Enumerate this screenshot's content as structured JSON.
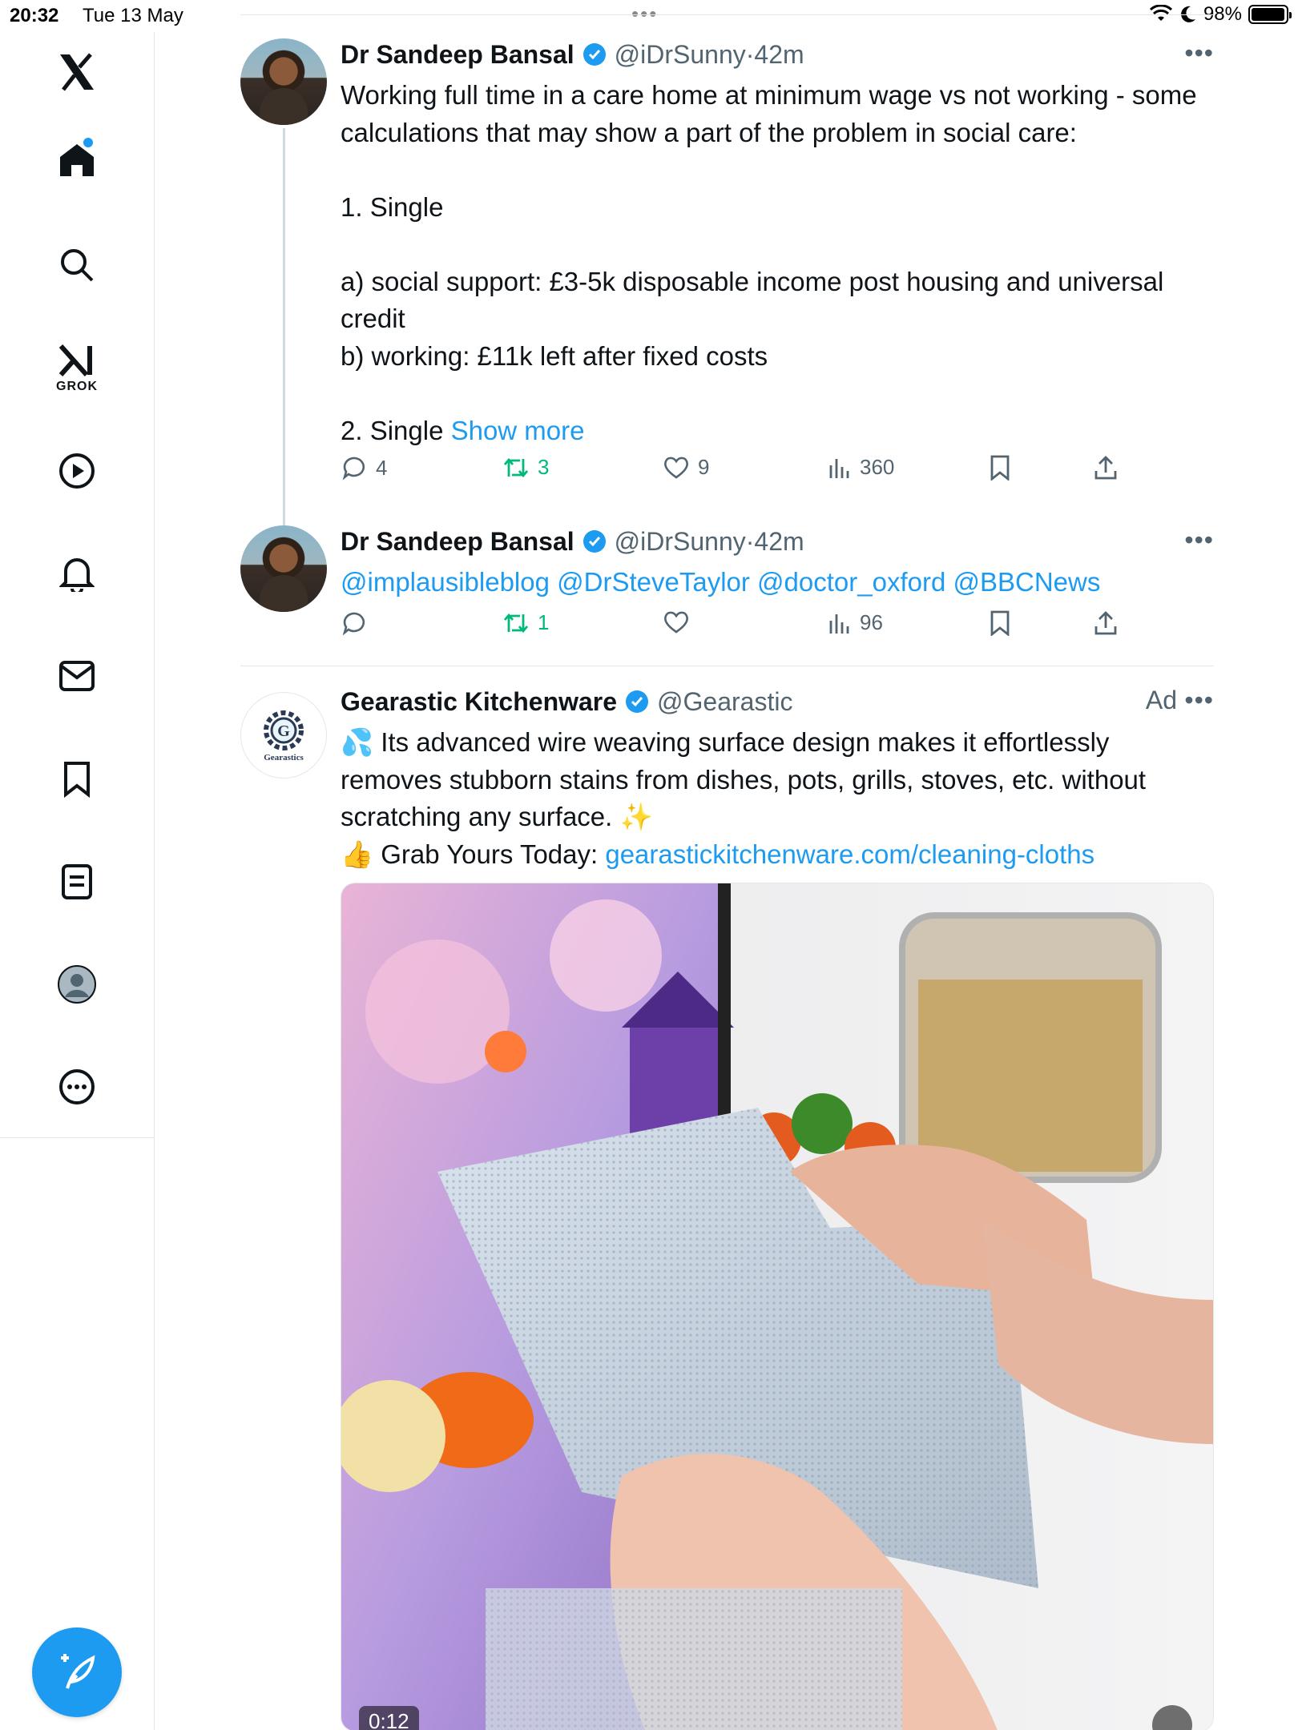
{
  "status_bar": {
    "time": "20:32",
    "date": "Tue 13 May",
    "battery": "98%",
    "battery_level": 0.98
  },
  "sidebar": {
    "grok_label": "GROK",
    "items": [
      "x-logo",
      "home",
      "search",
      "grok",
      "video",
      "notifications",
      "messages",
      "bookmarks",
      "lists",
      "profile",
      "more"
    ]
  },
  "tweets": [
    {
      "author": "Dr Sandeep Bansal",
      "handle": "@iDrSunny",
      "time": "42m",
      "text": "Working full time in a care home at minimum wage vs not working - some calculations that may show a part of the problem in social care:\n\n1. Single\n\na) social support: £3-5k disposable income post housing and universal credit\nb) working: £11k left after fixed costs\n\n2. Single ",
      "show_more": "Show more",
      "replies": "4",
      "reposts": "3",
      "likes": "9",
      "views": "360"
    },
    {
      "author": "Dr Sandeep Bansal",
      "handle": "@iDrSunny",
      "time": "42m",
      "mentions": "@implausibleblog @DrSteveTaylor @doctor_oxford @BBCNews",
      "replies": "",
      "reposts": "1",
      "likes": "",
      "views": "96"
    }
  ],
  "ad": {
    "author": "Gearastic Kitchenware",
    "handle": "@Gearastic",
    "label": "Ad",
    "avatar_text": "Gearastics",
    "line1": "💦 Its advanced wire weaving surface design makes it effortlessly removes stubborn stains from dishes, pots, grills, stoves, etc. without scratching any surface. ✨",
    "line2_prefix": "👍 Grab Yours Today: ",
    "link": "gearastickitchenware.com/cleaning-cloths",
    "video_duration": "0:12"
  },
  "colors": {
    "accent": "#1d9bf0",
    "repost": "#00ba7c",
    "muted": "#536471",
    "text": "#0f1419"
  }
}
